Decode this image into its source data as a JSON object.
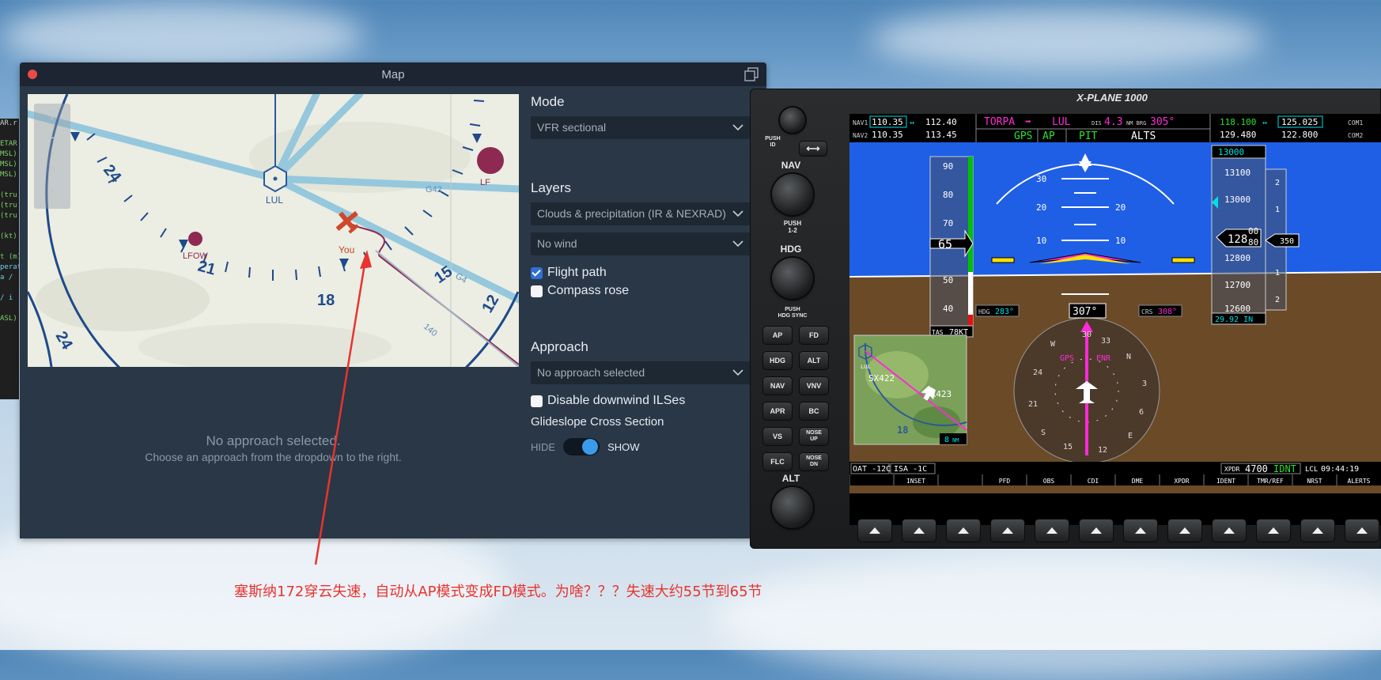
{
  "left_sliver": {
    "lines": [
      {
        "text": "AR.r",
        "color": "#cfcfcf"
      },
      {
        "text": "",
        "color": "#7bd36b"
      },
      {
        "text": "ETAR",
        "color": "#7bd36b"
      },
      {
        "text": "MSL)",
        "color": "#7bd36b"
      },
      {
        "text": "MSL)",
        "color": "#7bd36b"
      },
      {
        "text": "MSL)",
        "color": "#7bd36b"
      },
      {
        "text": "",
        "color": "#7bd36b"
      },
      {
        "text": "(tru",
        "color": "#7bd36b"
      },
      {
        "text": "(tru",
        "color": "#7bd36b"
      },
      {
        "text": "(tru",
        "color": "#7bd36b"
      },
      {
        "text": "",
        "color": "#7bd36b"
      },
      {
        "text": "(kt)",
        "color": "#7bd36b"
      },
      {
        "text": "",
        "color": "#7bd36b"
      },
      {
        "text": "t (m)",
        "color": "#7bd36b"
      },
      {
        "text": "perat",
        "color": "#6fd0e6"
      },
      {
        "text": "a /",
        "color": "#6fd0e6"
      },
      {
        "text": "",
        "color": "#6fd0e6"
      },
      {
        "text": "/ i",
        "color": "#6fd0e6"
      },
      {
        "text": "",
        "color": "#6fd0e6"
      },
      {
        "text": "ASL)",
        "color": "#7bd36b"
      }
    ]
  },
  "map_window": {
    "title": "Map",
    "canvas": {
      "labels": {
        "lul": "LUL",
        "lfow": "LFOW",
        "lfxx": "LF",
        "you": "You",
        "g42": "G42",
        "g4": "G4",
        "n140": "140",
        "n24a": "24",
        "n21": "21",
        "n18": "18",
        "n15": "15",
        "n12": "12",
        "n24b": "24"
      }
    },
    "empty_state": {
      "title": "No approach selected.",
      "subtitle": "Choose an approach from the dropdown to the right."
    },
    "mode": {
      "heading": "Mode",
      "value": "VFR sectional"
    },
    "layers": {
      "heading": "Layers",
      "weather_value": "Clouds & precipitation (IR & NEXRAD)",
      "wind_value": "No wind",
      "flight_path_label": "Flight path",
      "flight_path_checked": true,
      "compass_rose_label": "Compass rose",
      "compass_rose_checked": false
    },
    "approach": {
      "heading": "Approach",
      "value": "No approach selected",
      "disable_downwind_label": "Disable downwind ILSes",
      "disable_downwind_checked": false,
      "glideslope_heading": "Glideslope Cross Section",
      "toggle_off_label": "HIDE",
      "toggle_on_label": "SHOW",
      "toggle_state": "SHOW"
    }
  },
  "g1000": {
    "brand": "X-PLANE 1000",
    "left_panel": {
      "push_id": "PUSH\nID",
      "nav_label": "NAV",
      "push_12": "PUSH\n1-2",
      "hdg_label": "HDG",
      "push_hdg_sync": "PUSH\nHDG SYNC",
      "alt_label": "ALT",
      "buttons": [
        [
          "AP",
          "FD"
        ],
        [
          "HDG",
          "ALT"
        ],
        [
          "NAV",
          "VNV"
        ],
        [
          "APR",
          "BC"
        ],
        [
          "VS",
          "NOSE UP"
        ],
        [
          "FLC",
          "NOSE DN"
        ]
      ]
    },
    "top_bar": {
      "nav1_label": "NAV1",
      "nav1_active": "110.35",
      "nav1_standby": "112.40",
      "nav2_label": "NAV2",
      "nav2_active": "110.35",
      "nav2_standby": "113.45",
      "wpt_from": "TORPA",
      "wpt_arrow": "➡",
      "wpt_to": "LUL",
      "dis_label": "DIS",
      "dis_value": "4.3",
      "brg_label": "NM BRG",
      "brg_value": "305°",
      "ap_mode_lateral": "GPS",
      "ap_status": "AP",
      "ap_mode_pitch": "PIT",
      "ap_mode_alt": "ALTS",
      "com1_active": "118.100",
      "com1_standby": "125.025",
      "com1_label": "COM1",
      "com2_active": "129.480",
      "com2_standby": "122.800",
      "com2_label": "COM2"
    },
    "airspeed": {
      "ticks": [
        "90",
        "80",
        "70",
        "60",
        "50",
        "40"
      ],
      "current": "65",
      "current_high": "5",
      "current_low": "4",
      "tas_label": "TAS",
      "tas_value": "78KT"
    },
    "altitude": {
      "selected": "13000",
      "ticks": [
        "13100",
        "13000",
        "12900",
        "12800",
        "12700",
        "12600"
      ],
      "current_main": "128",
      "current_roll": "00",
      "current_roll_next": "80",
      "vsi_ticks": [
        "2",
        "1",
        "1",
        "2"
      ],
      "vsi_bug": "350",
      "baro": "29.92 IN"
    },
    "attitude": {
      "pitch_labels": [
        "30",
        "20",
        "10",
        "10"
      ],
      "pitch_ticks_left": [
        "30",
        "20",
        "10"
      ],
      "pitch_ticks_right": [
        "20",
        "10"
      ]
    },
    "hsi": {
      "heading": "307°",
      "hdg_bug_label": "HDG",
      "hdg_bug_value": "283°",
      "crs_label": "CRS",
      "crs_value": "308°",
      "source": "GPS",
      "phase": "ENR",
      "cards": [
        "33",
        "W",
        "30",
        "24",
        "21",
        "S",
        "15",
        "12",
        "E",
        "6",
        "3",
        "N"
      ]
    },
    "inset_map": {
      "wpt1": "SX422",
      "wpt2": "SX423",
      "runway_label": "18",
      "lul": "LUL",
      "range": "8",
      "range_unit": "NM"
    },
    "bottom_status": {
      "oat": "OAT -12C",
      "isa": "ISA -1C",
      "xpdr_label": "XPDR",
      "xpdr_code": "4700",
      "xpdr_mode": "IDNT",
      "clock_label": "LCL",
      "clock": "09:44:19"
    },
    "softkeys": [
      "",
      "INSET",
      "",
      "PFD",
      "OBS",
      "CDI",
      "DME",
      "XPDR",
      "IDENT",
      "TMR/REF",
      "NRST",
      "ALERTS"
    ]
  },
  "annotation": {
    "text": "塞斯纳172穿云失速，自动从AP模式变成FD模式。为啥？？？失速大约55节到65节",
    "color": "#e8332e"
  }
}
